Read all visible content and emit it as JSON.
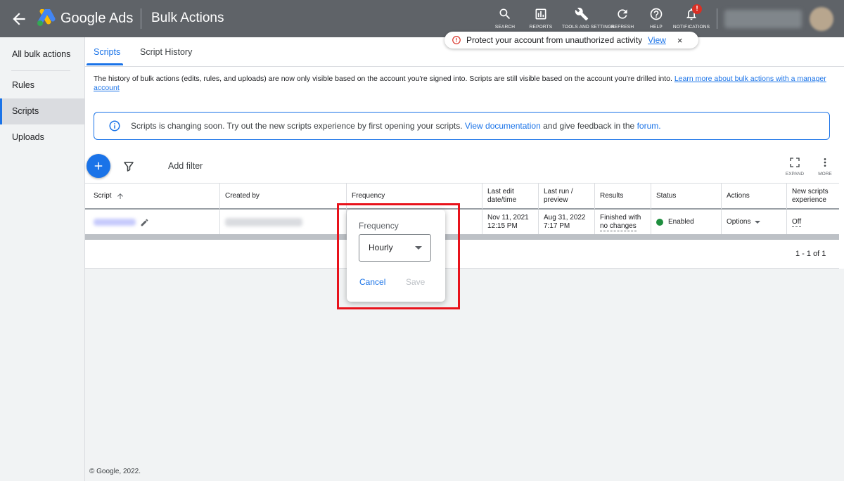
{
  "app": {
    "brand": "Google Ads",
    "section_title": "Bulk Actions"
  },
  "toolbar": {
    "search": "SEARCH",
    "reports": "REPORTS",
    "tools": "TOOLS AND SETTINGS",
    "refresh": "REFRESH",
    "help": "HELP",
    "notifications": "NOTIFICATIONS",
    "notification_badge": "!"
  },
  "protect_banner": {
    "text": "Protect your account from unauthorized activity",
    "link": "View",
    "close": "×"
  },
  "sidebar": {
    "items": [
      {
        "label": "All bulk actions"
      },
      {
        "label": "Rules"
      },
      {
        "label": "Scripts"
      },
      {
        "label": "Uploads"
      }
    ]
  },
  "tabs": [
    {
      "label": "Scripts"
    },
    {
      "label": "Script History"
    }
  ],
  "notice": {
    "text": "The history of bulk actions (edits, rules, and uploads) are now only visible based on the account you're signed into. Scripts are still visible based on the account you're drilled into.",
    "link": "Learn more about bulk actions with a manager account"
  },
  "info": {
    "text_before": "Scripts is changing soon. Try out the new scripts experience by first opening your scripts.",
    "link_docs": "View documentation",
    "text_middle": "and give feedback in the",
    "link_forum": "forum",
    "text_end": "."
  },
  "table_toolbar": {
    "add_filter": "Add filter",
    "expand": "EXPAND",
    "more": "MORE"
  },
  "columns": {
    "script": "Script",
    "created_by": "Created by",
    "frequency": "Frequency",
    "last_edit": "Last edit date/time",
    "last_run": "Last run / preview",
    "results": "Results",
    "status": "Status",
    "actions": "Actions",
    "new_exp": "New scripts experience"
  },
  "row": {
    "last_edit_date": "Nov 11, 2021",
    "last_edit_time": "12:15 PM",
    "last_run_date": "Aug 31, 2022",
    "last_run_time": "7:17 PM",
    "results_line1": "Finished with",
    "results_line2": "no changes",
    "status": "Enabled",
    "status_color": "#1e8e3e",
    "actions": "Options",
    "new_exp": "Off"
  },
  "pager": "1 - 1 of 1",
  "frequency_popup": {
    "label": "Frequency",
    "selected": "Hourly",
    "cancel": "Cancel",
    "save": "Save"
  },
  "footer": "© Google, 2022."
}
